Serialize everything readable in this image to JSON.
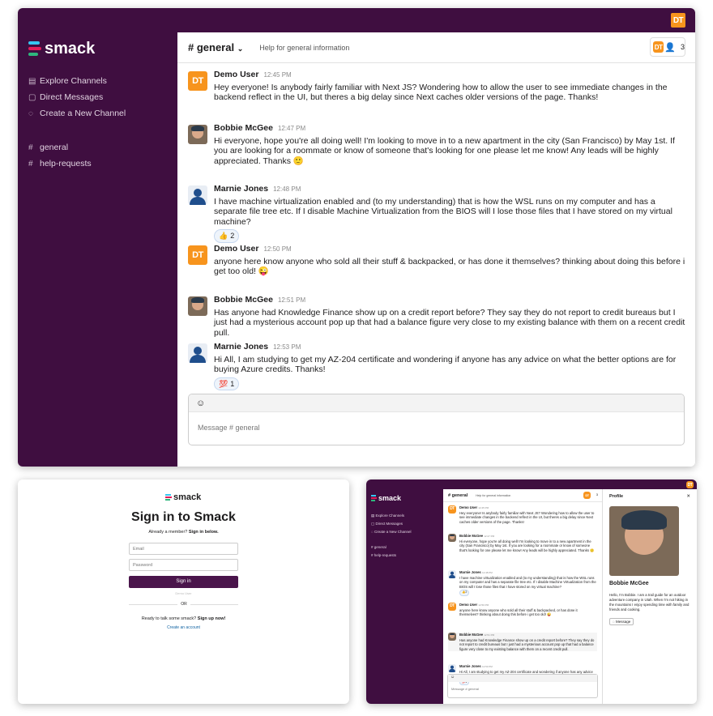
{
  "app": {
    "name": "smack",
    "user_initials": "DT"
  },
  "sidebar": {
    "nav": [
      {
        "label": "Explore Channels",
        "icon": "channels-icon"
      },
      {
        "label": "Direct Messages",
        "icon": "messages-icon"
      },
      {
        "label": "Create a New Channel",
        "icon": "chat-bubble-icon"
      }
    ],
    "channels": [
      "general",
      "help-requests"
    ]
  },
  "channel": {
    "name": "# general",
    "description": "Help for general information",
    "member_count": "3"
  },
  "messages": [
    {
      "author": "Demo User",
      "avatar": "dt",
      "time": "12:45 PM",
      "text": "Hey everyone! Is anybody fairly familiar with Next JS? Wondering how to allow the user to see immediate changes in the backend reflect in the UI, but theres a big delay since Next caches older versions of the page. Thanks!"
    },
    {
      "author": "Bobbie McGee",
      "avatar": "photo",
      "time": "12:47 PM",
      "text": "Hi everyone, hope you're all doing well! I'm looking to move in to a new apartment in the city (San Francisco) by May 1st. If you are looking for a roommate or know of someone that's looking for one please let me know! Any leads will be highly appreciated. Thanks 🙂"
    },
    {
      "author": "Marnie Jones",
      "avatar": "person",
      "time": "12:48 PM",
      "text": "I have machine virtualization enabled and (to my understanding) that is how the WSL runs on my computer and has a separate file tree etc. If I disable Machine Virtualization from the BIOS will I lose those files that I have stored on my virtual machine?",
      "reaction": {
        "emoji": "👍",
        "count": "2"
      }
    },
    {
      "author": "Demo User",
      "avatar": "dt",
      "time": "12:50 PM",
      "text": "anyone here know anyone who sold all their stuff & backpacked, or has done it themselves? thinking about doing this before i get too old! 😜"
    },
    {
      "author": "Bobbie McGee",
      "avatar": "photo",
      "time": "12:51 PM",
      "text": "Has anyone had Knowledge Finance show up on a credit report before? They say they do not report to credit bureaus but I just had a mysterious account pop up that had a balance figure very close to my existing balance with them on a recent credit pull."
    },
    {
      "author": "Marnie Jones",
      "avatar": "person",
      "time": "12:53 PM",
      "text": "Hi All, I am studying to get my AZ-204 certificate and wondering if anyone has any advice on what the better options are for buying Azure credits. Thanks!",
      "reaction": {
        "emoji": "💯",
        "count": "1"
      }
    }
  ],
  "composer": {
    "placeholder": "Message # general",
    "emoji_icon": "smiley-icon"
  },
  "login": {
    "title": "Sign in to Smack",
    "member_prompt": "Already a member?",
    "member_link": "Sign in below.",
    "email_placeholder": "Email",
    "password_placeholder": "Password",
    "button": "Sign in",
    "demo_link": "Demo User",
    "or": "OR",
    "signup_prompt": "Ready to talk some smack?",
    "signup_link": "Sign up now!",
    "create_link": "Create an account"
  },
  "profile": {
    "title": "Profile",
    "name": "Bobbie McGee",
    "bio": "Hello, I'm Bobbie. I am a trail guide for an outdoor adventure company in Utah. When I'm not hiking in the mountains I enjoy spending time with family and friends and cooking.",
    "button": "Message"
  }
}
